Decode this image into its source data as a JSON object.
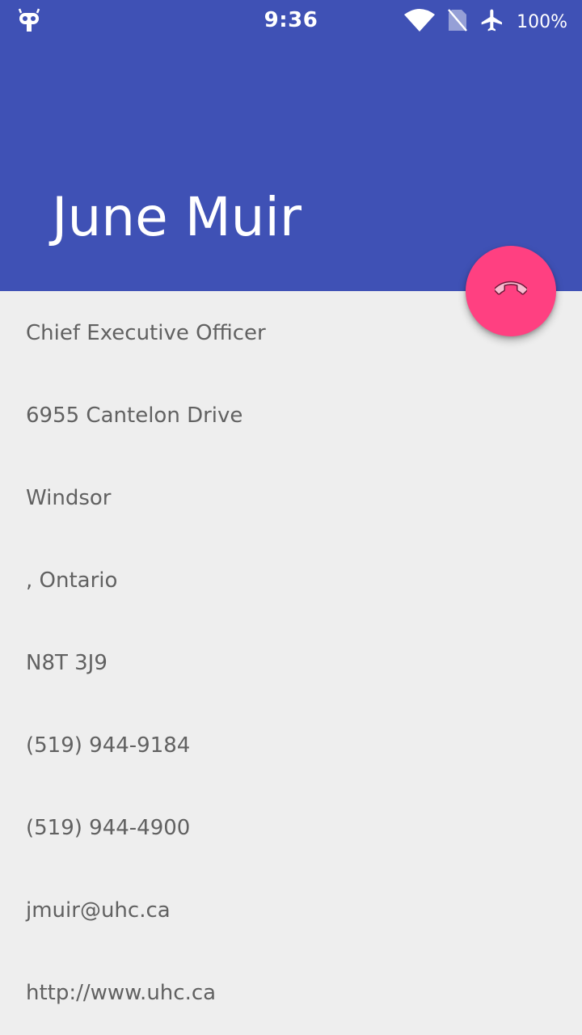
{
  "status_bar": {
    "time": "9:36",
    "battery": "100%",
    "icons": [
      "cyanogen-mod-icon",
      "wifi-icon",
      "no-sim-icon",
      "airplane-mode-icon"
    ]
  },
  "contact": {
    "name": "June Muir",
    "details": [
      "Chief Executive Officer",
      "6955 Cantelon Drive",
      "Windsor",
      ", Ontario",
      "N8T 3J9",
      "(519) 944-9184",
      "(519) 944-4900",
      "jmuir@uhc.ca",
      "http://www.uhc.ca"
    ]
  },
  "fab": {
    "icon": "phone-icon"
  },
  "colors": {
    "primary": "#3f51b5",
    "accent": "#ff4081",
    "background": "#eeeeee",
    "text": "#616161"
  }
}
